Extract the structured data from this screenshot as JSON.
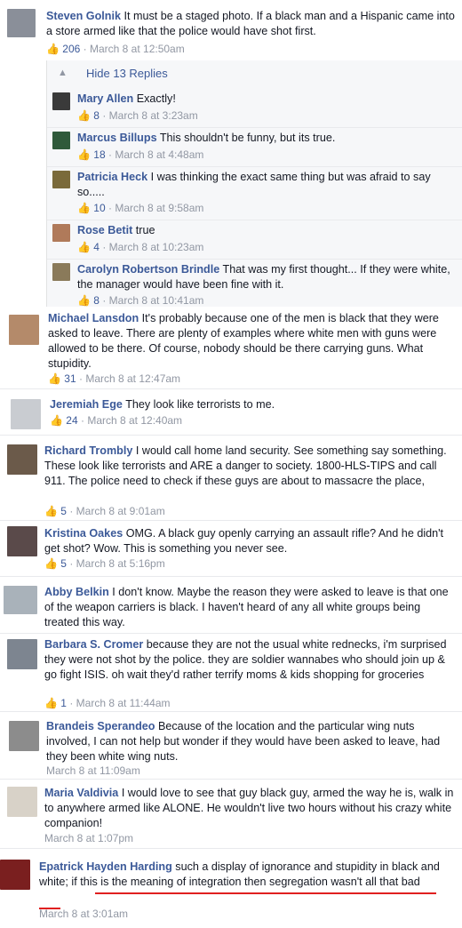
{
  "comments": [
    {
      "author": "Steven Golnik",
      "text": "It must be a staged photo. If a black man and a Hispanic came into a store armed like that the police would have shot first.",
      "likes": "206",
      "time": "March 8 at 12:50am",
      "avatar_color": "#8a8f99"
    },
    {
      "author": "Michael Lansdon",
      "text": "It's probably because one of the men is black that they were asked to leave. There are plenty of examples where white men with guns were allowed to be there. Of course, nobody should be there carrying guns. What stupidity.",
      "likes": "31",
      "time": "March 8 at 12:47am",
      "avatar_color": "#b48a6a"
    },
    {
      "author": "Jeremiah Ege",
      "text": "They look like terrorists to me.",
      "likes": "24",
      "time": "March 8 at 12:40am",
      "avatar_color": "#c9ccd1"
    },
    {
      "author": "Richard Trombly",
      "text": "I would call home land security. See something say something. These look like terrorists and ARE a danger to society. 1800-HLS-TIPS and call 911. The police need to check if these guys are about to massacre the place,",
      "likes": "5",
      "time": "March 8 at 9:01am",
      "avatar_color": "#6b5a4a"
    },
    {
      "author": "Kristina Oakes",
      "text": "OMG. A black guy openly carrying an assault rifle? And he didn't get shot? Wow. This is something you never see.",
      "likes": "5",
      "time": "March 8 at 5:16pm",
      "avatar_color": "#5a4a4a"
    },
    {
      "author": "Abby Belkin",
      "text": "I don't know. Maybe the reason they were asked to leave is that one of the weapon carriers is black. I haven't heard of any all white groups being treated this way.",
      "likes": "",
      "time": "",
      "avatar_color": "#a9b2ba"
    },
    {
      "author": "Barbara S. Cromer",
      "text": "because they are not the usual white rednecks, i'm surprised they were not shot by the police. they are soldier wannabes who should join up & go fight ISIS. oh wait they'd rather terrify moms & kids shopping for groceries",
      "likes": "1",
      "time": "March 8 at 11:44am",
      "avatar_color": "#7d8590"
    },
    {
      "author": "Brandeis Sperandeo",
      "text": "Because of the location and the particular wing nuts involved, I can not help but wonder if they would have been asked to leave, had they been white wing nuts.",
      "likes": "",
      "time": "March 8 at 11:09am",
      "avatar_color": "#8c8c8c"
    },
    {
      "author": "Maria Valdivia",
      "text": "I would love to see that guy black guy, armed the way he is, walk in to anywhere armed like ALONE. He wouldn't live two hours without his crazy white companion!",
      "likes": "",
      "time": "March 8 at 1:07pm",
      "avatar_color": "#d8d2c8"
    },
    {
      "author": "Epatrick Hayden Harding",
      "text": "such a display of ignorance and stupidity in black and white; if this is the meaning of integration then segregation wasn't all that bad",
      "likes": "",
      "time": "March 8 at 3:01am",
      "avatar_color": "#7a1f1f"
    }
  ],
  "replies_toggle": "Hide 13 Replies",
  "replies": [
    {
      "author": "Mary Allen",
      "text": "Exactly!",
      "likes": "8",
      "time": "March 8 at 3:23am",
      "avatar_color": "#3a3a3a"
    },
    {
      "author": "Marcus Billups",
      "text": "This shouldn't be funny, but its true.",
      "likes": "18",
      "time": "March 8 at 4:48am",
      "avatar_color": "#2f5a3a"
    },
    {
      "author": "Patricia Heck",
      "text": "I was thinking the exact same thing but was afraid to say so.....",
      "likes": "10",
      "time": "March 8 at 9:58am",
      "avatar_color": "#7a6a3a"
    },
    {
      "author": "Rose Betit",
      "text": "true",
      "likes": "4",
      "time": "March 8 at 10:23am",
      "avatar_color": "#b07a5a"
    },
    {
      "author": "Carolyn Robertson Brindle",
      "text": "That was my first thought... If they were white, the manager would have been fine with it.",
      "likes": "8",
      "time": "March 8 at 10:41am",
      "avatar_color": "#8a7a5a"
    }
  ],
  "accent_color": "#3b5998",
  "underline_color": "#e02020"
}
